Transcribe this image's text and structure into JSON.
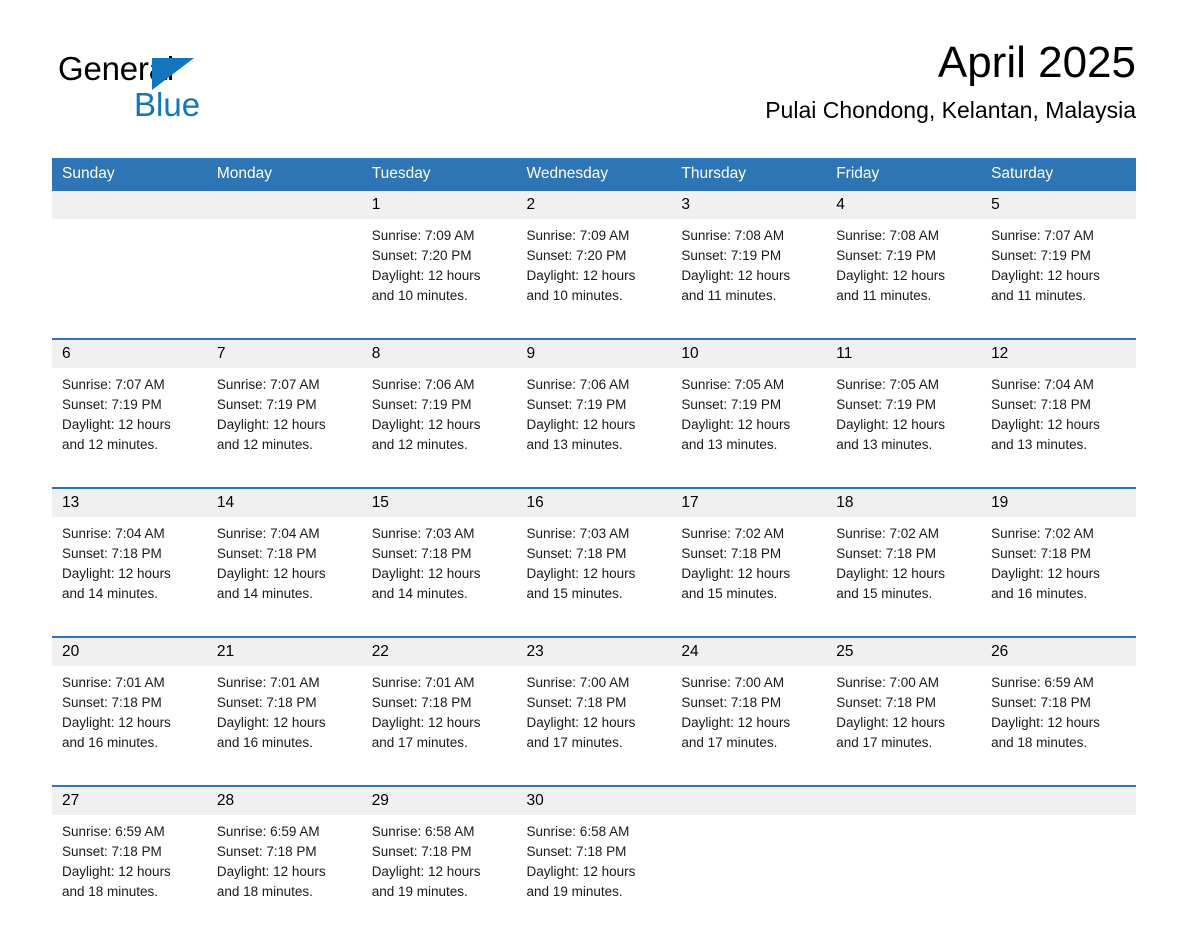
{
  "logo": {
    "word1": "General",
    "word2": "Blue",
    "accent_color": "#1275bd",
    "triangle_icon": "triangle-icon"
  },
  "header": {
    "title": "April 2025",
    "location": "Pulai Chondong, Kelantan, Malaysia"
  },
  "theme": {
    "header_blue": "#2e75b6",
    "daynum_band": "#f0f0f0",
    "cell_bg": "#ffffff",
    "text": "#000000"
  },
  "calendar": {
    "weekday_headers": [
      "Sunday",
      "Monday",
      "Tuesday",
      "Wednesday",
      "Thursday",
      "Friday",
      "Saturday"
    ],
    "weeks": [
      [
        {
          "day": "",
          "sunrise": "",
          "sunset": "",
          "daylight1": "",
          "daylight2": ""
        },
        {
          "day": "",
          "sunrise": "",
          "sunset": "",
          "daylight1": "",
          "daylight2": ""
        },
        {
          "day": "1",
          "sunrise": "Sunrise: 7:09 AM",
          "sunset": "Sunset: 7:20 PM",
          "daylight1": "Daylight: 12 hours",
          "daylight2": "and 10 minutes."
        },
        {
          "day": "2",
          "sunrise": "Sunrise: 7:09 AM",
          "sunset": "Sunset: 7:20 PM",
          "daylight1": "Daylight: 12 hours",
          "daylight2": "and 10 minutes."
        },
        {
          "day": "3",
          "sunrise": "Sunrise: 7:08 AM",
          "sunset": "Sunset: 7:19 PM",
          "daylight1": "Daylight: 12 hours",
          "daylight2": "and 11 minutes."
        },
        {
          "day": "4",
          "sunrise": "Sunrise: 7:08 AM",
          "sunset": "Sunset: 7:19 PM",
          "daylight1": "Daylight: 12 hours",
          "daylight2": "and 11 minutes."
        },
        {
          "day": "5",
          "sunrise": "Sunrise: 7:07 AM",
          "sunset": "Sunset: 7:19 PM",
          "daylight1": "Daylight: 12 hours",
          "daylight2": "and 11 minutes."
        }
      ],
      [
        {
          "day": "6",
          "sunrise": "Sunrise: 7:07 AM",
          "sunset": "Sunset: 7:19 PM",
          "daylight1": "Daylight: 12 hours",
          "daylight2": "and 12 minutes."
        },
        {
          "day": "7",
          "sunrise": "Sunrise: 7:07 AM",
          "sunset": "Sunset: 7:19 PM",
          "daylight1": "Daylight: 12 hours",
          "daylight2": "and 12 minutes."
        },
        {
          "day": "8",
          "sunrise": "Sunrise: 7:06 AM",
          "sunset": "Sunset: 7:19 PM",
          "daylight1": "Daylight: 12 hours",
          "daylight2": "and 12 minutes."
        },
        {
          "day": "9",
          "sunrise": "Sunrise: 7:06 AM",
          "sunset": "Sunset: 7:19 PM",
          "daylight1": "Daylight: 12 hours",
          "daylight2": "and 13 minutes."
        },
        {
          "day": "10",
          "sunrise": "Sunrise: 7:05 AM",
          "sunset": "Sunset: 7:19 PM",
          "daylight1": "Daylight: 12 hours",
          "daylight2": "and 13 minutes."
        },
        {
          "day": "11",
          "sunrise": "Sunrise: 7:05 AM",
          "sunset": "Sunset: 7:19 PM",
          "daylight1": "Daylight: 12 hours",
          "daylight2": "and 13 minutes."
        },
        {
          "day": "12",
          "sunrise": "Sunrise: 7:04 AM",
          "sunset": "Sunset: 7:18 PM",
          "daylight1": "Daylight: 12 hours",
          "daylight2": "and 13 minutes."
        }
      ],
      [
        {
          "day": "13",
          "sunrise": "Sunrise: 7:04 AM",
          "sunset": "Sunset: 7:18 PM",
          "daylight1": "Daylight: 12 hours",
          "daylight2": "and 14 minutes."
        },
        {
          "day": "14",
          "sunrise": "Sunrise: 7:04 AM",
          "sunset": "Sunset: 7:18 PM",
          "daylight1": "Daylight: 12 hours",
          "daylight2": "and 14 minutes."
        },
        {
          "day": "15",
          "sunrise": "Sunrise: 7:03 AM",
          "sunset": "Sunset: 7:18 PM",
          "daylight1": "Daylight: 12 hours",
          "daylight2": "and 14 minutes."
        },
        {
          "day": "16",
          "sunrise": "Sunrise: 7:03 AM",
          "sunset": "Sunset: 7:18 PM",
          "daylight1": "Daylight: 12 hours",
          "daylight2": "and 15 minutes."
        },
        {
          "day": "17",
          "sunrise": "Sunrise: 7:02 AM",
          "sunset": "Sunset: 7:18 PM",
          "daylight1": "Daylight: 12 hours",
          "daylight2": "and 15 minutes."
        },
        {
          "day": "18",
          "sunrise": "Sunrise: 7:02 AM",
          "sunset": "Sunset: 7:18 PM",
          "daylight1": "Daylight: 12 hours",
          "daylight2": "and 15 minutes."
        },
        {
          "day": "19",
          "sunrise": "Sunrise: 7:02 AM",
          "sunset": "Sunset: 7:18 PM",
          "daylight1": "Daylight: 12 hours",
          "daylight2": "and 16 minutes."
        }
      ],
      [
        {
          "day": "20",
          "sunrise": "Sunrise: 7:01 AM",
          "sunset": "Sunset: 7:18 PM",
          "daylight1": "Daylight: 12 hours",
          "daylight2": "and 16 minutes."
        },
        {
          "day": "21",
          "sunrise": "Sunrise: 7:01 AM",
          "sunset": "Sunset: 7:18 PM",
          "daylight1": "Daylight: 12 hours",
          "daylight2": "and 16 minutes."
        },
        {
          "day": "22",
          "sunrise": "Sunrise: 7:01 AM",
          "sunset": "Sunset: 7:18 PM",
          "daylight1": "Daylight: 12 hours",
          "daylight2": "and 17 minutes."
        },
        {
          "day": "23",
          "sunrise": "Sunrise: 7:00 AM",
          "sunset": "Sunset: 7:18 PM",
          "daylight1": "Daylight: 12 hours",
          "daylight2": "and 17 minutes."
        },
        {
          "day": "24",
          "sunrise": "Sunrise: 7:00 AM",
          "sunset": "Sunset: 7:18 PM",
          "daylight1": "Daylight: 12 hours",
          "daylight2": "and 17 minutes."
        },
        {
          "day": "25",
          "sunrise": "Sunrise: 7:00 AM",
          "sunset": "Sunset: 7:18 PM",
          "daylight1": "Daylight: 12 hours",
          "daylight2": "and 17 minutes."
        },
        {
          "day": "26",
          "sunrise": "Sunrise: 6:59 AM",
          "sunset": "Sunset: 7:18 PM",
          "daylight1": "Daylight: 12 hours",
          "daylight2": "and 18 minutes."
        }
      ],
      [
        {
          "day": "27",
          "sunrise": "Sunrise: 6:59 AM",
          "sunset": "Sunset: 7:18 PM",
          "daylight1": "Daylight: 12 hours",
          "daylight2": "and 18 minutes."
        },
        {
          "day": "28",
          "sunrise": "Sunrise: 6:59 AM",
          "sunset": "Sunset: 7:18 PM",
          "daylight1": "Daylight: 12 hours",
          "daylight2": "and 18 minutes."
        },
        {
          "day": "29",
          "sunrise": "Sunrise: 6:58 AM",
          "sunset": "Sunset: 7:18 PM",
          "daylight1": "Daylight: 12 hours",
          "daylight2": "and 19 minutes."
        },
        {
          "day": "30",
          "sunrise": "Sunrise: 6:58 AM",
          "sunset": "Sunset: 7:18 PM",
          "daylight1": "Daylight: 12 hours",
          "daylight2": "and 19 minutes."
        },
        {
          "day": "",
          "sunrise": "",
          "sunset": "",
          "daylight1": "",
          "daylight2": ""
        },
        {
          "day": "",
          "sunrise": "",
          "sunset": "",
          "daylight1": "",
          "daylight2": ""
        },
        {
          "day": "",
          "sunrise": "",
          "sunset": "",
          "daylight1": "",
          "daylight2": ""
        }
      ]
    ]
  }
}
